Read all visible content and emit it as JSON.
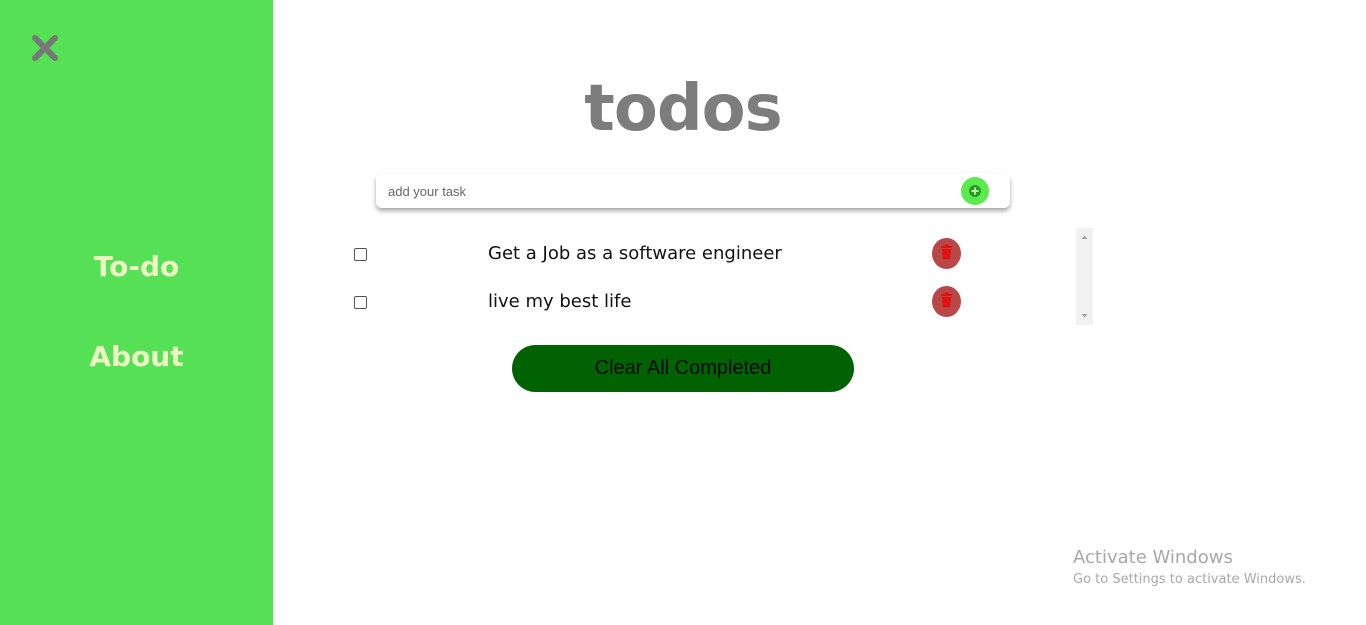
{
  "sidebar": {
    "close_icon": "close-icon",
    "items": [
      {
        "label": "To-do"
      },
      {
        "label": "About"
      }
    ],
    "background": "#55e055"
  },
  "main": {
    "title": "todos",
    "input": {
      "placeholder": "add your task",
      "value": ""
    },
    "add_icon": "plus-circle-icon",
    "todos": [
      {
        "text": "Get a Job as a software engineer",
        "checked": false
      },
      {
        "text": "live my best life",
        "checked": false
      }
    ],
    "delete_icon": "trash-icon",
    "clear_button": "Clear All Completed"
  },
  "watermark": {
    "title": "Activate Windows",
    "subtitle": "Go to Settings to activate Windows."
  },
  "colors": {
    "accent_green": "#55e055",
    "clear_button": "#006200",
    "delete_button": "#b84848",
    "trash_icon": "#e01010"
  }
}
